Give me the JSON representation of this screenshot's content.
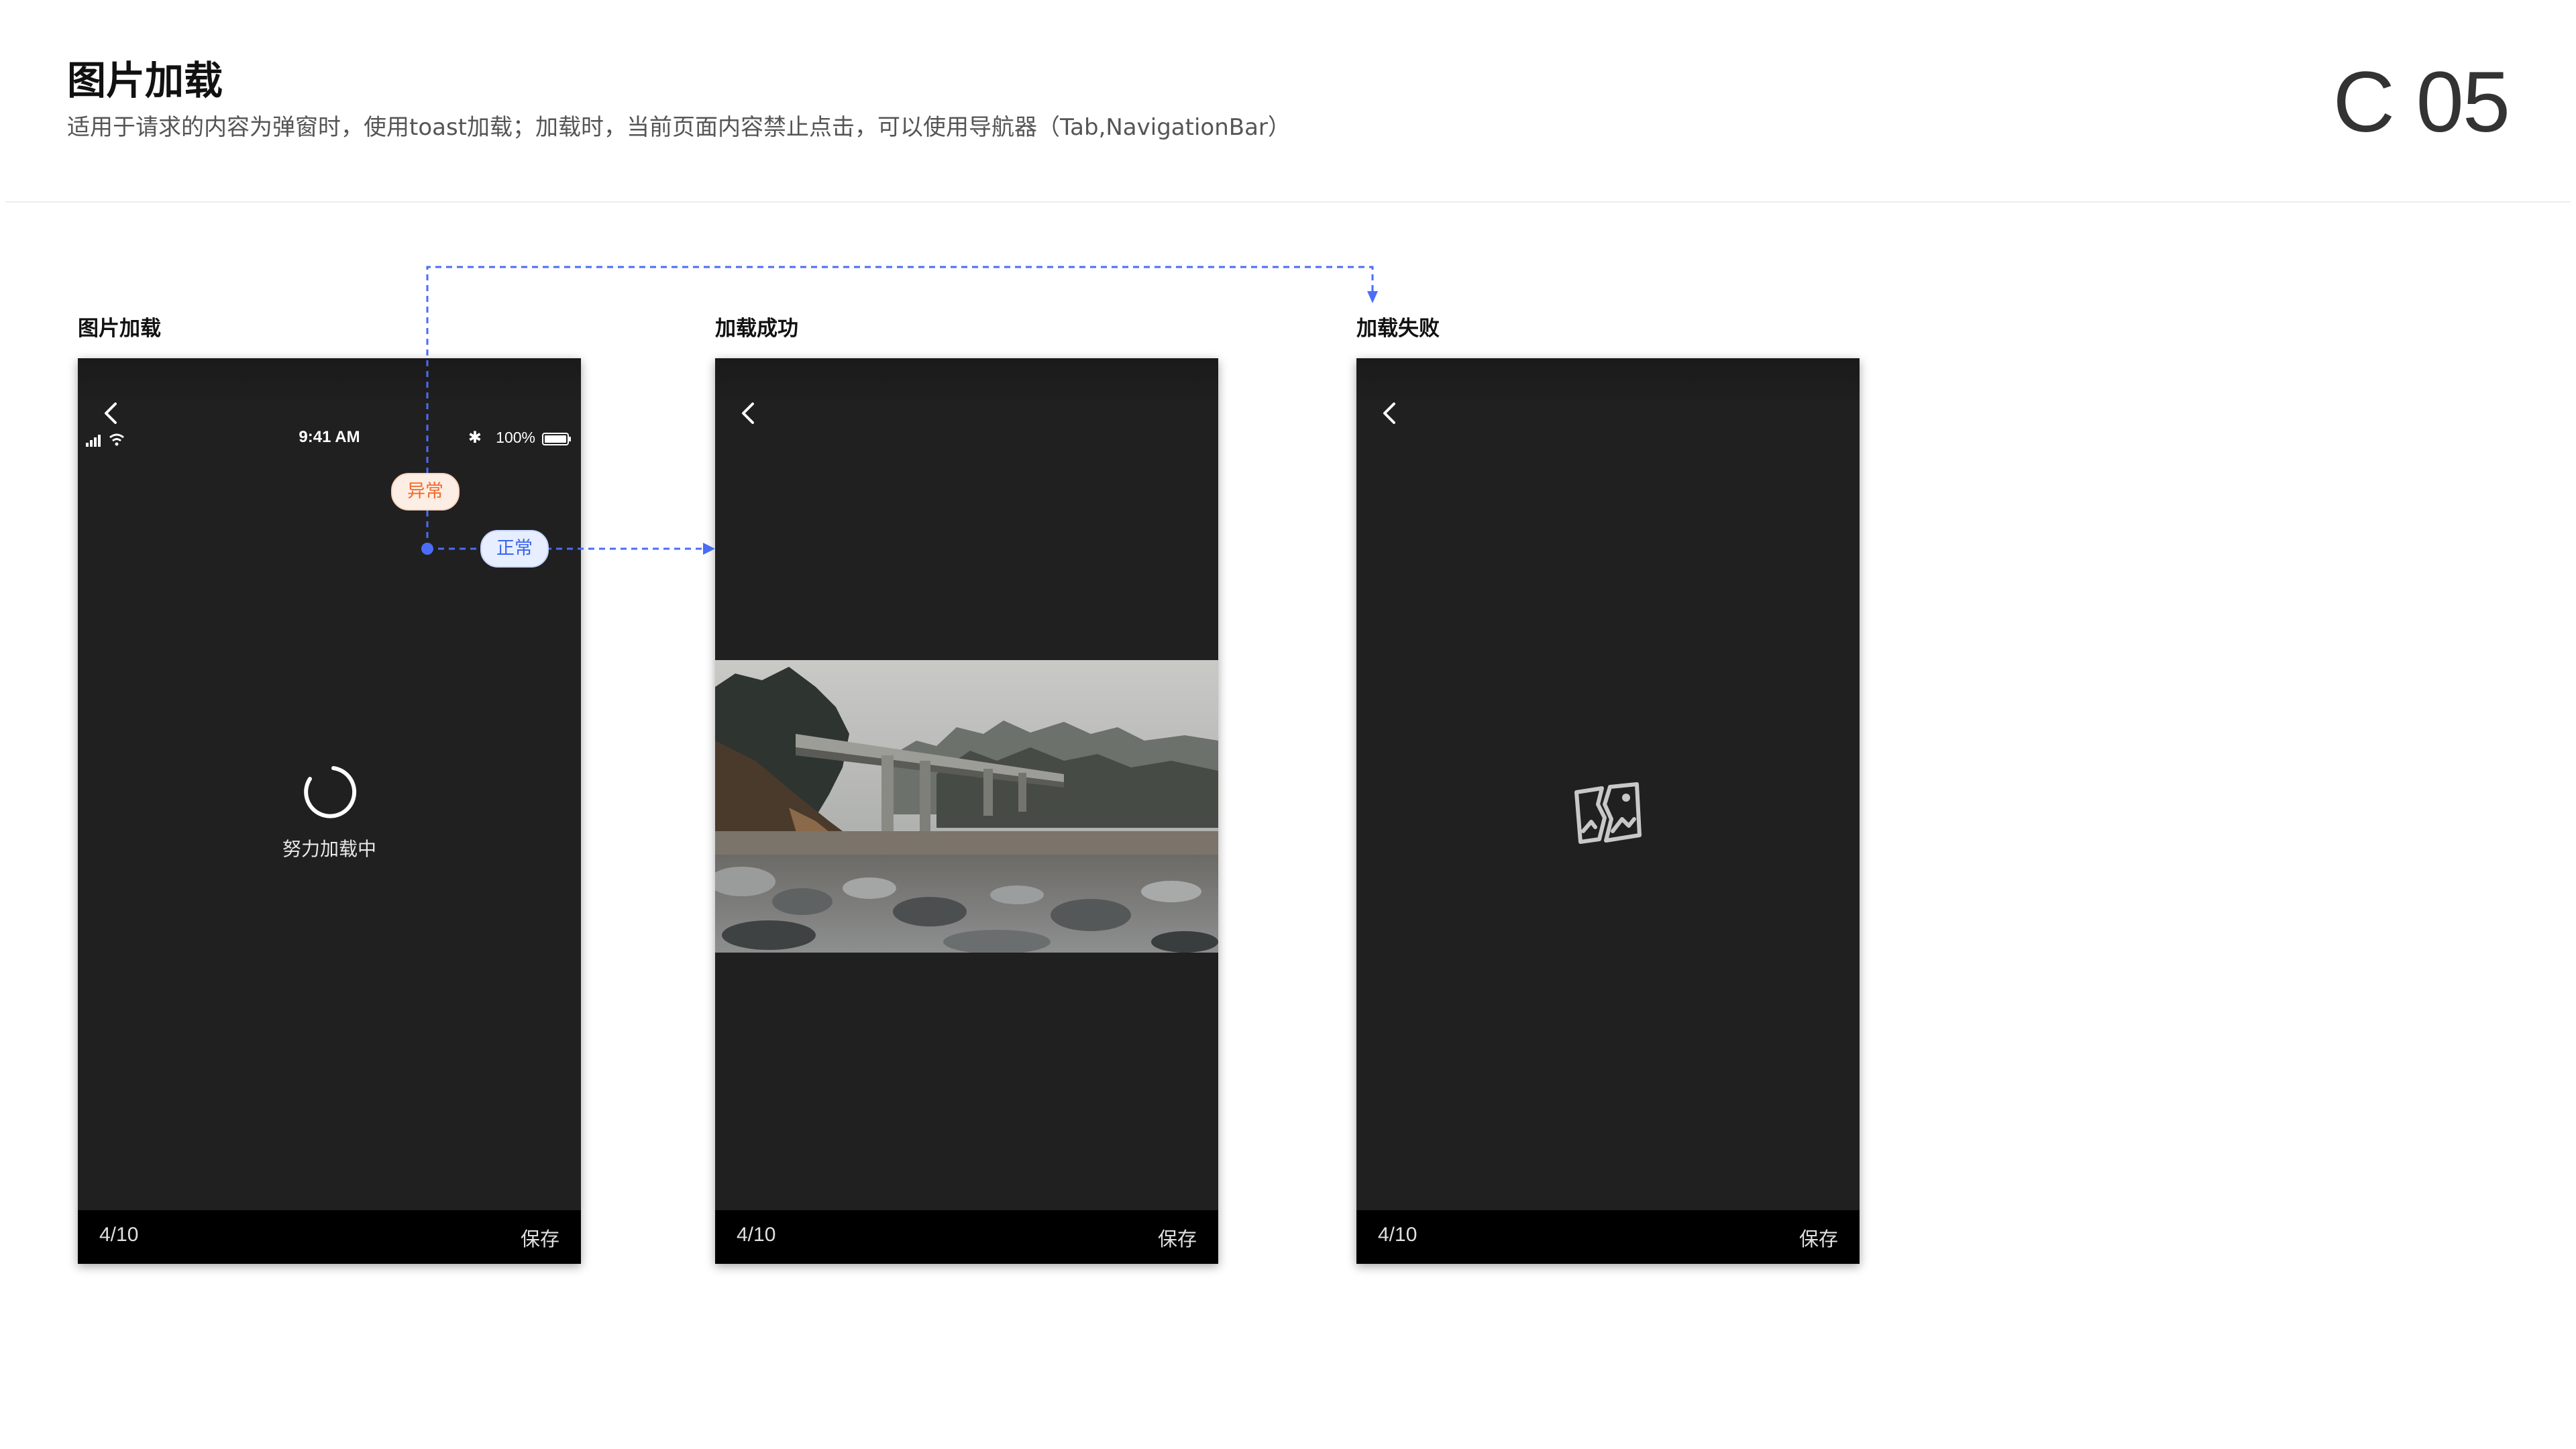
{
  "header": {
    "title": "图片加载",
    "description": "适用于请求的内容为弹窗时，使用toast加载；加载时，当前页面内容禁止点击，可以使用导航器（Tab,NavigationBar）",
    "code": "C 05"
  },
  "colors": {
    "page_background": "#ffffff",
    "screen_background": "#202020",
    "bottom_bar": "#000000",
    "flow_line": "#4a6cf7",
    "tag_abnormal_text": "#f26b2a",
    "tag_normal_text": "#3a64f0"
  },
  "screens": [
    {
      "label": "图片加载",
      "status_bar": {
        "time": "9:41 AM",
        "battery": "100%",
        "icons": [
          "signal-icon",
          "wifi-icon",
          "bluetooth-icon",
          "battery-icon"
        ]
      },
      "loading_text": "努力加载中",
      "pager": "4/10",
      "save_label": "保存"
    },
    {
      "label": "加载成功",
      "image": "bridge-over-rocky-river-photo",
      "pager": "4/10",
      "save_label": "保存"
    },
    {
      "label": "加载失败",
      "icon": "broken-image-icon",
      "pager": "4/10",
      "save_label": "保存"
    }
  ],
  "flow": {
    "abnormal_label": "异常",
    "normal_label": "正常"
  }
}
